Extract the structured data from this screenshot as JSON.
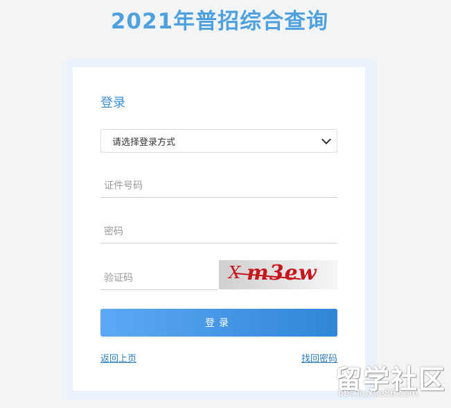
{
  "page": {
    "title": "2021年普招综合查询"
  },
  "card": {
    "heading": "登录"
  },
  "form": {
    "login_method_selected": "请选择登录方式",
    "id_placeholder": "证件号码",
    "password_placeholder": "密码",
    "captcha_placeholder": "验证码",
    "captcha_text": "m3ew",
    "captcha_mark": "X",
    "submit_label": "登录"
  },
  "links": {
    "back": "返回上页",
    "forgot": "找回密码"
  },
  "watermark": {
    "main": "留学社区",
    "sub": "bbs.liuxue86.com"
  },
  "colors": {
    "accent": "#4ea1de",
    "button_start": "#5da9f6",
    "button_end": "#2f86d6",
    "captcha": "#c4161c"
  },
  "icons": {
    "select_arrow": "chevron-down-icon"
  }
}
